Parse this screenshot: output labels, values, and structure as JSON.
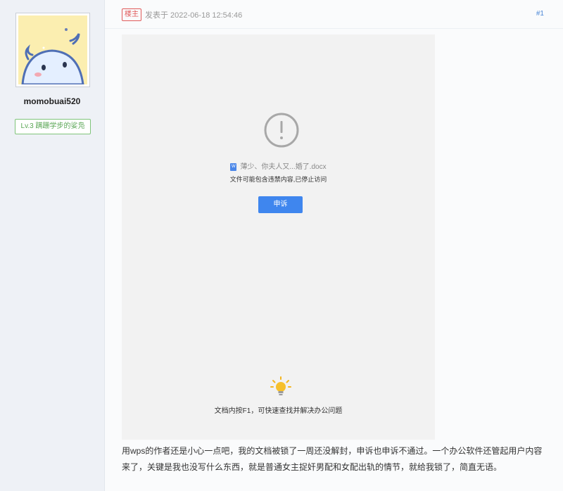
{
  "user": {
    "name": "momobuai520",
    "level": "Lv.3 蹒跚学步的娑凫"
  },
  "post": {
    "op_badge": "楼主",
    "posted_at": "发表于 2022-06-18 12:54:46",
    "floor": "#1",
    "body": "用wps的作者还是小心一点吧，我的文档被锁了一周还没解封，申诉也申诉不通过。一个办公软件还管起用户内容来了，关键是我也没写什么东西，就是普通女主捉奸男配和女配出轨的情节，就给我锁了，简直无语。"
  },
  "screenshot": {
    "file_name": "薄少、你夫人又...婚了.docx",
    "file_type_icon": "W",
    "blocked_message": "文件可能包含违禁内容,已停止访问",
    "appeal_button": "申诉",
    "tip": "文档内按F1，可快速查找并解决办公问题",
    "icons": [
      "warning-icon",
      "doc-icon",
      "lightbulb-icon"
    ]
  },
  "colors": {
    "accent_blue": "#3f86ee",
    "badge_red": "#e05a5a",
    "level_green": "#5aa655",
    "sidebar_bg": "#eef1f6"
  }
}
